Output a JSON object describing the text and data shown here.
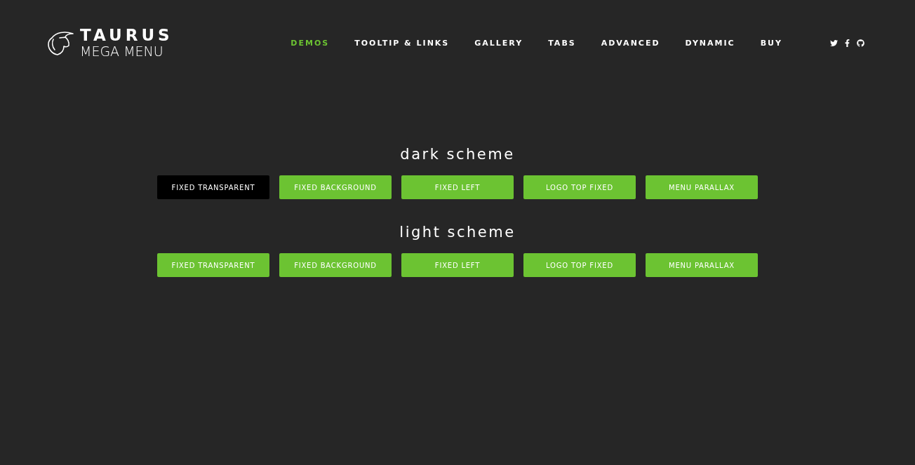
{
  "logo": {
    "title": "TAURUS",
    "subtitle": "MEGA MENU"
  },
  "nav": [
    {
      "label": "DEMOS",
      "selected": true
    },
    {
      "label": "TOOLTIP & LINKS",
      "selected": false
    },
    {
      "label": "GALLERY",
      "selected": false
    },
    {
      "label": "TABS",
      "selected": false
    },
    {
      "label": "ADVANCED",
      "selected": false
    },
    {
      "label": "DYNAMIC",
      "selected": false
    },
    {
      "label": "BUY",
      "selected": false
    }
  ],
  "social": [
    {
      "kind": "twitter"
    },
    {
      "kind": "facebook"
    },
    {
      "kind": "github"
    }
  ],
  "sections": [
    {
      "title": "dark scheme",
      "buttons": [
        {
          "label": "FIXED TRANSPARENT",
          "selected": true
        },
        {
          "label": "FIXED BACKGROUND",
          "selected": false
        },
        {
          "label": "FIXED LEFT",
          "selected": false
        },
        {
          "label": "LOGO TOP FIXED",
          "selected": false
        },
        {
          "label": "MENU PARALLAX",
          "selected": false
        }
      ]
    },
    {
      "title": "light scheme",
      "buttons": [
        {
          "label": "FIXED TRANSPARENT",
          "selected": false
        },
        {
          "label": "FIXED BACKGROUND",
          "selected": false
        },
        {
          "label": "FIXED LEFT",
          "selected": false
        },
        {
          "label": "LOGO TOP FIXED",
          "selected": false
        },
        {
          "label": "MENU PARALLAX",
          "selected": false
        }
      ]
    }
  ]
}
